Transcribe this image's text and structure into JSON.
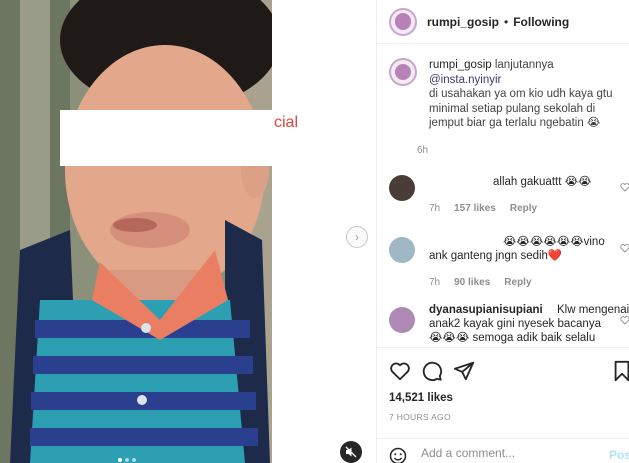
{
  "media": {
    "overlay_text": "cial",
    "next_icon": "chevron-right-icon",
    "mute_icon": "speaker-muted-icon"
  },
  "header": {
    "username": "rumpi_gosip",
    "separator": "•",
    "follow_status": "Following"
  },
  "caption": {
    "username": "rumpi_gosip",
    "lead": "lanjutannya",
    "mention": "@insta.nyinyir",
    "body": "di usahakan ya om kio udh kaya gtu minimal setiap pulang sekolah di jemput biar ga terlalu ngebatin 😭",
    "time": "6h"
  },
  "comments": [
    {
      "text": "allah gakuattt 😭😭",
      "time": "7h",
      "likes": "157 likes",
      "reply": "Reply"
    },
    {
      "text_line1": "😭😭😭😭😭😭vino",
      "text_line2": "ank ganteng jngn sedih❤️",
      "time": "7h",
      "likes": "90 likes",
      "reply": "Reply"
    },
    {
      "username": "dyanasupianisupiani",
      "text_line1": "Klw mengenai",
      "text_line2": "anak2 kayak gini nyesek bacanya",
      "text_line3": "😭😭😭 semoga adik baik selalu"
    }
  ],
  "actions": {
    "likes": "14,521 likes",
    "posted": "7 HOURS AGO"
  },
  "comment_box": {
    "placeholder": "Add a comment...",
    "post_label": "Post"
  },
  "colors": {
    "accent_blue": "#0095f6",
    "post_disabled": "#b2dffc",
    "overlay_red": "#e0403e"
  }
}
